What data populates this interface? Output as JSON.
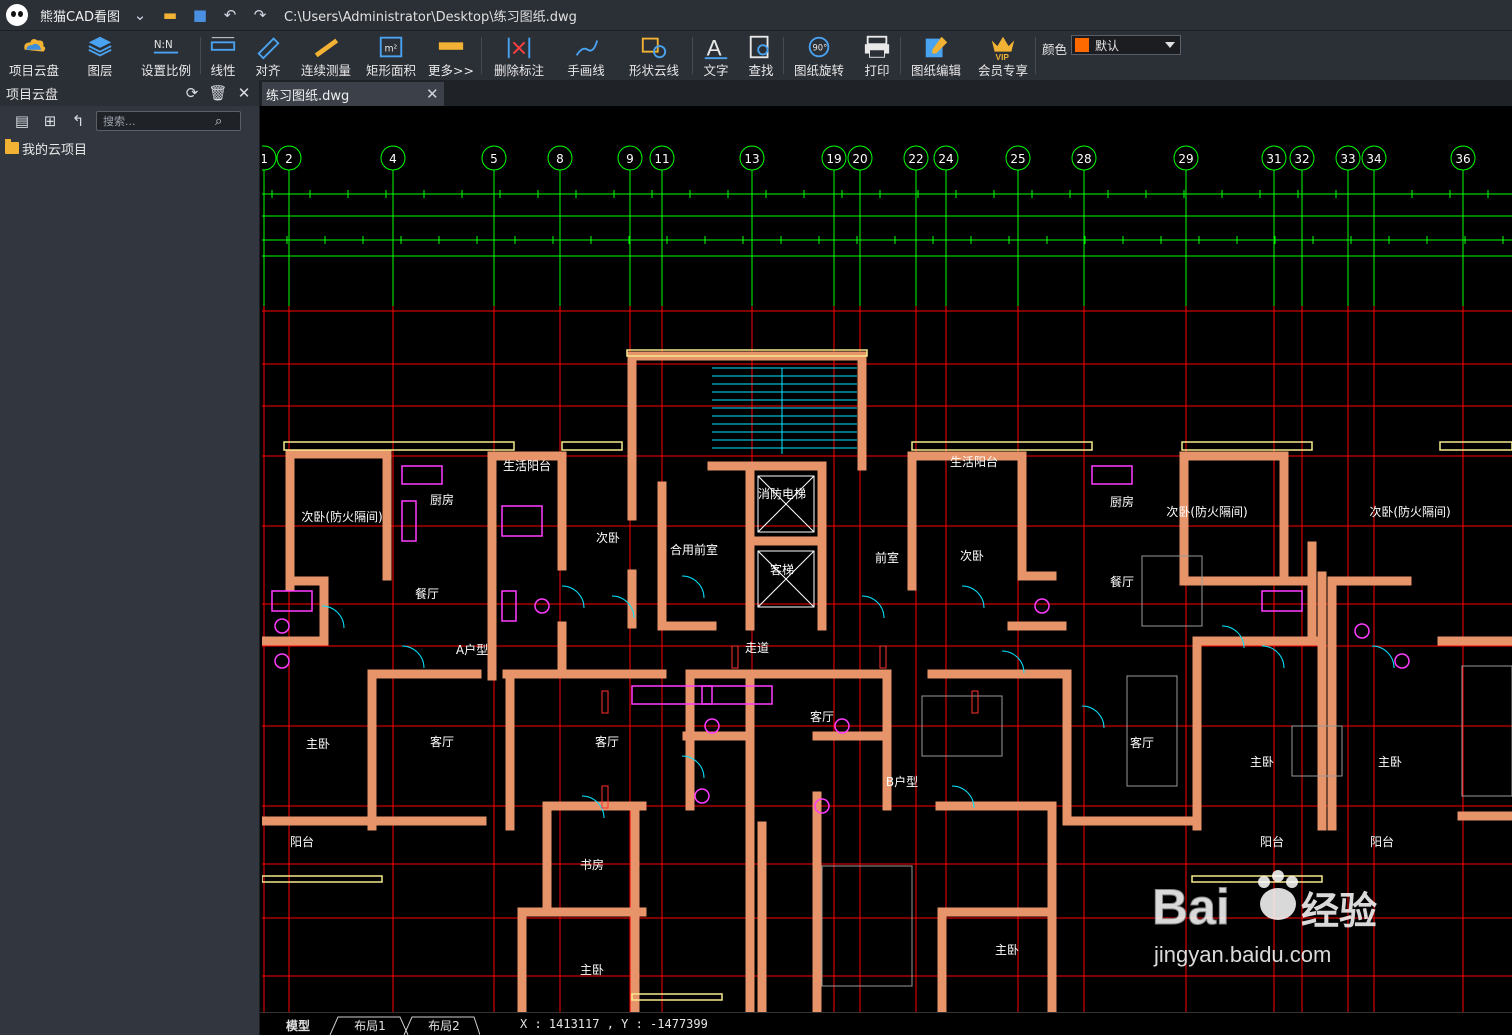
{
  "app": {
    "name": "熊猫CAD看图",
    "file_path": "C:\\Users\\Administrator\\Desktop\\练习图纸.dwg"
  },
  "toolbar": {
    "items": [
      {
        "label": "项目云盘",
        "icon": "cloud-disk-icon"
      },
      {
        "label": "图层",
        "icon": "layers-icon"
      },
      {
        "label": "设置比例",
        "icon": "scale-icon"
      },
      {
        "label": "线性",
        "icon": "linear-measure-icon"
      },
      {
        "label": "对齐",
        "icon": "aligned-measure-icon"
      },
      {
        "label": "连续测量",
        "icon": "continuous-measure-icon"
      },
      {
        "label": "矩形面积",
        "icon": "rect-area-icon"
      },
      {
        "label": "更多>>",
        "icon": "more-ruler-icon"
      },
      {
        "label": "删除标注",
        "icon": "delete-dimension-icon"
      },
      {
        "label": "手画线",
        "icon": "freehand-icon"
      },
      {
        "label": "形状云线",
        "icon": "shape-cloud-icon"
      },
      {
        "label": "文字",
        "icon": "text-icon"
      },
      {
        "label": "查找",
        "icon": "find-icon"
      },
      {
        "label": "图纸旋转",
        "icon": "rotate-icon"
      },
      {
        "label": "打印",
        "icon": "print-icon"
      },
      {
        "label": "图纸编辑",
        "icon": "drawing-edit-icon"
      },
      {
        "label": "会员专享",
        "icon": "vip-icon"
      }
    ],
    "color_label": "颜色",
    "color_value": "默认",
    "color_swatch": "#ff6a00"
  },
  "left_panel": {
    "title": "项目云盘",
    "search_placeholder": "搜索...",
    "tree": [
      {
        "label": "我的云项目"
      }
    ]
  },
  "document": {
    "tab_label": "练习图纸.dwg"
  },
  "bottom": {
    "tabs": [
      "模型",
      "布局1",
      "布局2"
    ],
    "coordinates": "X : 1413117 , Y : -1477399"
  },
  "drawing": {
    "axis_labels": [
      "1",
      "2",
      "4",
      "5",
      "8",
      "9",
      "11",
      "13",
      "19",
      "20",
      "22",
      "24",
      "25",
      "28",
      "29",
      "31",
      "32",
      "33",
      "34",
      "36"
    ],
    "room_labels": [
      "次卧(防火隔间)",
      "厨房",
      "生活阳台",
      "餐厅",
      "主卧",
      "客厅",
      "次卧",
      "合用前室",
      "前室",
      "书房",
      "阳台",
      "走道",
      "A户型",
      "B户型",
      "消防电梯",
      "客梯"
    ]
  },
  "watermark": {
    "brand": "Baidu 经验",
    "url": "jingyan.baidu.com"
  },
  "colors": {
    "chrome": "#2b2f36",
    "panel": "#31363f",
    "wall": "#e8946a",
    "axis": "#00ff00",
    "grid": "#ff0000"
  }
}
